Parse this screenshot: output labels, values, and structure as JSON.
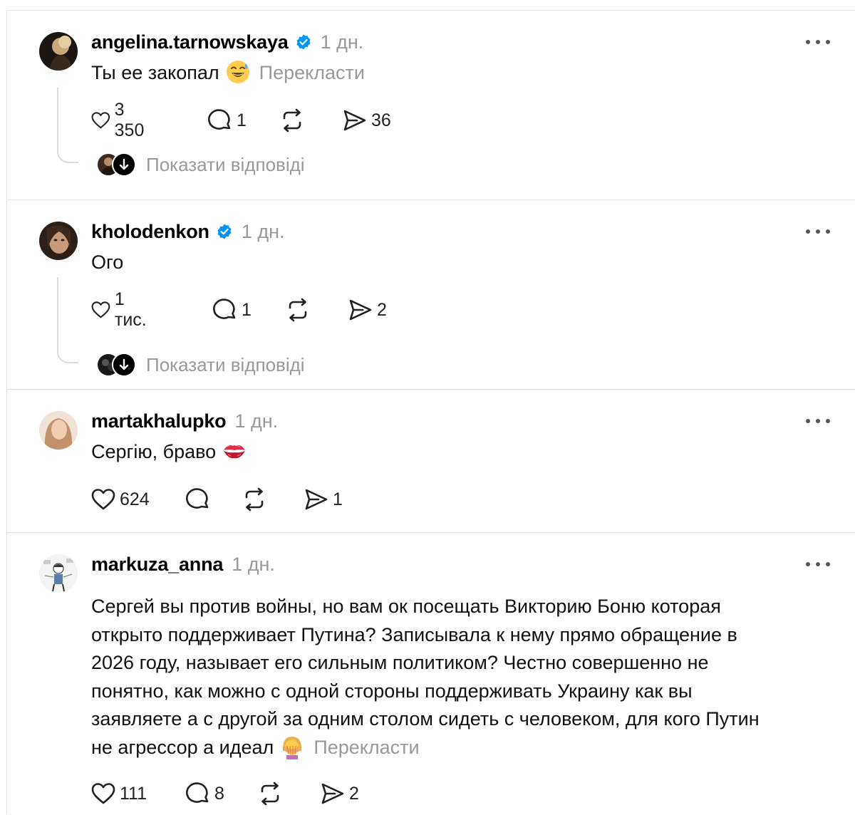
{
  "posts": [
    {
      "username": "angelina.tarnowskaya",
      "verified": true,
      "time": "1 дн.",
      "text": "Ты ее закопал",
      "emoji": "sweat-smile-emoji",
      "translate_label": "Перекласти",
      "likes": "3 350",
      "replies": "1",
      "reposts": "",
      "shares": "36",
      "show_replies_label": "Показати відповіді"
    },
    {
      "username": "kholodenkon",
      "verified": true,
      "time": "1 дн.",
      "text": "Ого",
      "likes": "1 тис.",
      "replies": "1",
      "reposts": "",
      "shares": "2",
      "show_replies_label": "Показати відповіді"
    },
    {
      "username": "martakhalupko",
      "verified": false,
      "time": "1 дн.",
      "text": "Сергію, браво",
      "emoji": "kiss-mark-emoji",
      "likes": "624",
      "replies": "",
      "reposts": "",
      "shares": "1"
    },
    {
      "username": "markuza_anna",
      "verified": false,
      "time": "1 дн.",
      "text_lines": [
        "Сергей вы против войны, но вам ок посещать Викторию Боню которая",
        "открыто поддерживает Путина? Записывала к нему прямо обращение в",
        "2026 году, называет его сильным политиком? Честно совершенно не",
        "понятно, как можно с одной стороны поддерживать Украину как вы",
        "заявляете а с другой за одним столом сидеть с человеком, для кого Путин",
        "не агрессор а идеал"
      ],
      "emoji": "woman-facepalming-emoji",
      "translate_label": "Перекласти",
      "likes": "111",
      "replies": "8",
      "reposts": "",
      "shares": "2"
    }
  ],
  "icons": {
    "like": "heart-icon",
    "reply": "speech-bubble-icon",
    "repost": "repost-icon",
    "share": "paper-plane-icon",
    "more": "more-options-icon",
    "verified": "verified-badge-icon",
    "replies_badge": "arrow-down-icon"
  },
  "colors": {
    "secondary_text": "#999999",
    "verified_blue": "#0095f6",
    "divider": "#e3e3e3"
  }
}
